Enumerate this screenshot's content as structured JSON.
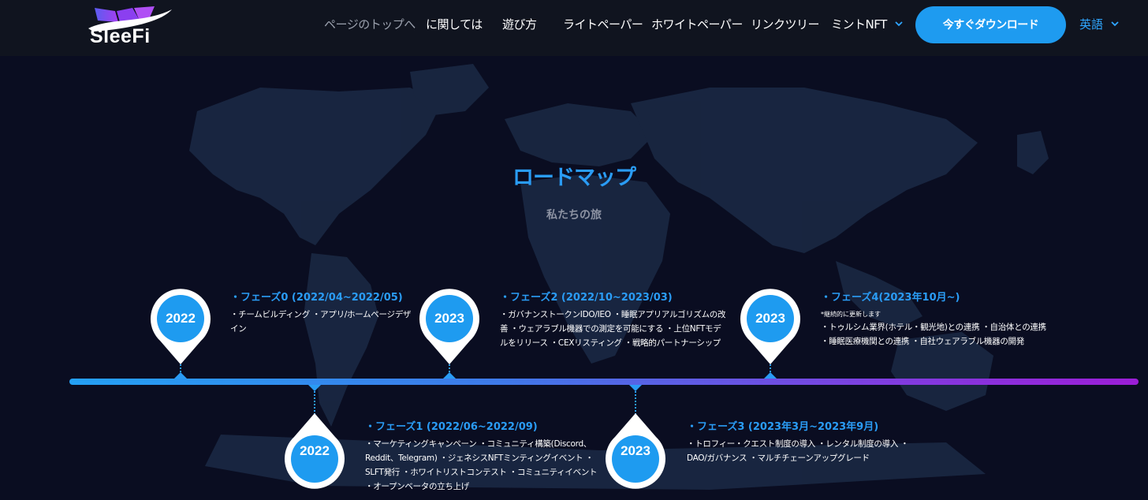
{
  "header": {
    "logo_text": "SleeFi",
    "nav": [
      {
        "label": "ページのトップへ"
      },
      {
        "label": "に関しては"
      },
      {
        "label": "遊び方"
      },
      {
        "label": "ライトペーパー"
      },
      {
        "label": "ホワイトペーパー"
      },
      {
        "label": "リンクツリー"
      },
      {
        "label": "ミントNFT"
      }
    ],
    "download_button": "今すぐダウンロード",
    "language": "英語",
    "accent_color": "#1e9bf0"
  },
  "roadmap": {
    "title": "ロードマップ",
    "subtitle": "私たちの旅",
    "phases": [
      {
        "year": "2022",
        "title": "・フェーズ0 (2022/04~2022/05)",
        "description": "・チームビルディング ・アプリ/ホームページデザイン"
      },
      {
        "year": "2022",
        "title": "・フェーズ1 (2022/06~2022/09)",
        "description": "・マーケティングキャンペーン ・コミュニティ構築(Discord、Reddit、Telegram) ・ジェネシスNFTミンティングイベント ・SLFT発行 ・ホワイトリストコンテスト ・コミュニティイベント ・オープンベータの立ち上げ"
      },
      {
        "year": "2023",
        "title": "・フェーズ2 (2022/10~2023/03)",
        "description": "・ガバナンストークンIDO/IEO ・睡眠アプリアルゴリズムの改善 ・ウェアラブル機器での測定を可能にする ・上位NFTモデルをリリース ・CEXリスティング ・戦略的パートナーシップ"
      },
      {
        "year": "2023",
        "title": "・フェーズ3 (2023年3月~2023年9月)",
        "description": "・トロフィー・クエスト制度の導入 ・レンタル制度の導入 ・DAO/ガバナンス ・マルチチェーンアップグレード"
      },
      {
        "year": "2023",
        "title": "・フェーズ4(2023年10月~)",
        "note": "*継続的に更新します",
        "description": "・トゥルシム業界(ホテル・観光地)との連携 ・自治体との連携 ・睡眠医療機関との連携 ・自社ウェアラブル機器の開発"
      }
    ],
    "gradient_colors": [
      "#24a0f4",
      "#9b1dd6"
    ]
  }
}
